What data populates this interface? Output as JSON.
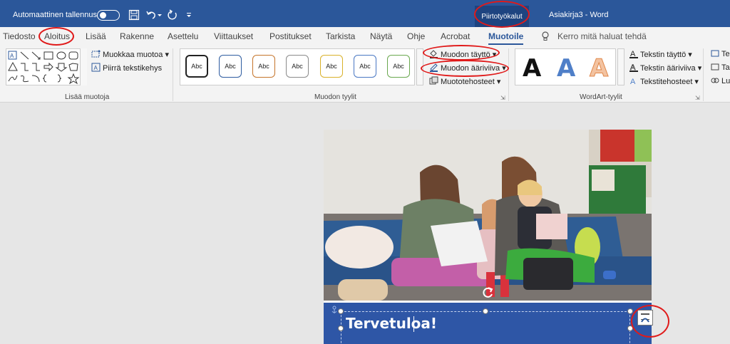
{
  "titlebar": {
    "autosave_label": "Automaattinen tallennus",
    "tool_tab": "Piirtotyökalut",
    "doc_title": "Asiakirja3  -  Word",
    "color": "#2b579a"
  },
  "tabs": [
    "Tiedosto",
    "Aloitus",
    "Lisää",
    "Rakenne",
    "Asettelu",
    "Viittaukset",
    "Postitukset",
    "Tarkista",
    "Näytä",
    "Ohje",
    "Acrobat",
    "Muotoile"
  ],
  "tell_me": "Kerro mitä haluat tehdä",
  "ribbon": {
    "insert_shapes": {
      "label": "Lisää muotoja",
      "edit_shape": "Muokkaa muotoa",
      "draw_textbox": "Piirrä tekstikehys"
    },
    "shape_styles": {
      "label": "Muodon tyylit",
      "style_text": "Abc",
      "styles": [
        "#222222",
        "#2e5ca0",
        "#c5742a",
        "#8a8a8a",
        "#d9b12a",
        "#4a78c3",
        "#6aa84f"
      ],
      "shape_fill": "Muodon täyttö",
      "shape_outline": "Muodon ääriviiva",
      "shape_effects": "Muototehosteet"
    },
    "wordart": {
      "label": "WordArt-tyylit",
      "letter": "A",
      "text_fill": "Tekstin täyttö",
      "text_outline": "Tekstin ääriviiva",
      "text_effects": "Tekstitehosteet"
    },
    "cut_off": [
      "Tek",
      "Tas",
      "Lu"
    ]
  },
  "document": {
    "heading": "Tervetuloa!",
    "banner_color": "#2e56a6"
  },
  "annotation_color": "#e01a1a"
}
